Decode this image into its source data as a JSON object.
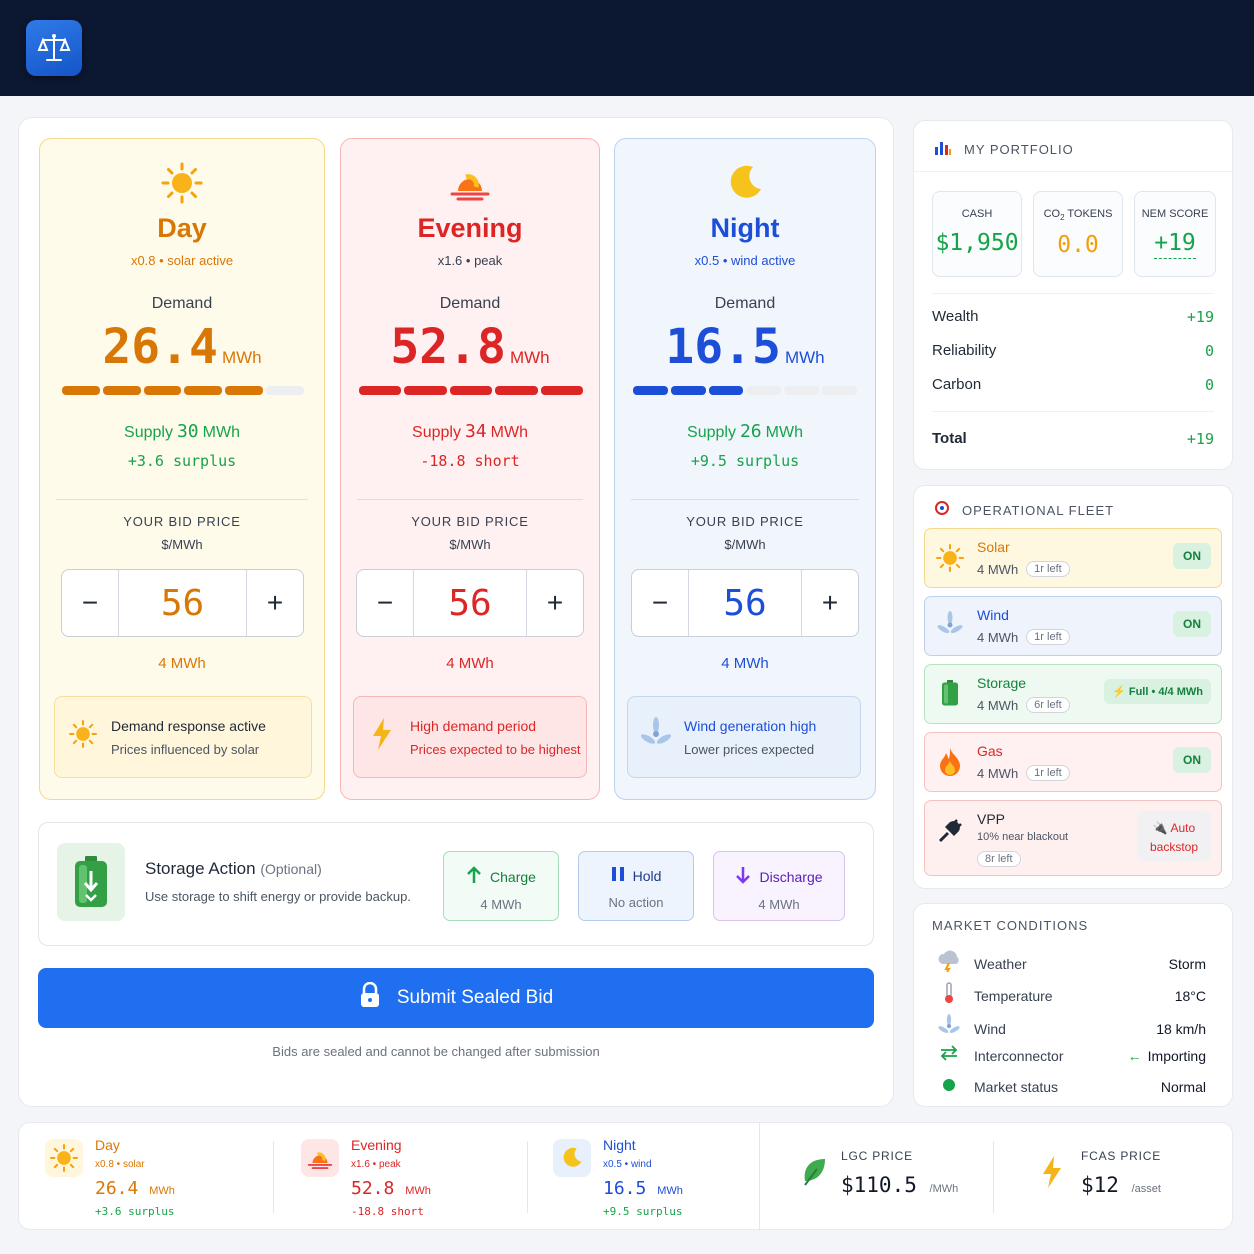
{
  "colors": {
    "day": "#d97706",
    "evening": "#dc2626",
    "night": "#1d4ed8",
    "green": "#16a34a",
    "primary": "#1f6ff0"
  },
  "header": {
    "logo_icon": "scales-icon"
  },
  "periods": [
    {
      "name": "Day",
      "mult": "x0.8",
      "mult_note": "solar active",
      "demand_label": "Demand",
      "demand": "26.4",
      "unit": "MWh",
      "demand_fill": 0.82,
      "supply_label": "Supply",
      "supply": "30",
      "balance": "+3.6 surplus",
      "bid_label": "YOUR BID PRICE",
      "bid_unit": "$/MWh",
      "bid": "56",
      "qty": "4 MWh",
      "note_title": "Demand response active",
      "note_text": "Prices influenced by solar",
      "note_icon": "sun-icon"
    },
    {
      "name": "Evening",
      "mult": "x1.6",
      "mult_note": "peak",
      "demand_label": "Demand",
      "demand": "52.8",
      "unit": "MWh",
      "demand_fill": 1.0,
      "supply_label": "Supply",
      "supply": "34",
      "balance": "-18.8 short",
      "bid_label": "YOUR BID PRICE",
      "bid_unit": "$/MWh",
      "bid": "56",
      "qty": "4 MWh",
      "note_title": "High demand period",
      "note_text": "Prices expected to be highest",
      "note_icon": "lightning-icon"
    },
    {
      "name": "Night",
      "mult": "x0.5",
      "mult_note": "wind active",
      "demand_label": "Demand",
      "demand": "16.5",
      "unit": "MWh",
      "demand_fill": 0.52,
      "supply_label": "Supply",
      "supply": "26",
      "balance": "+9.5 surplus",
      "bid_label": "YOUR BID PRICE",
      "bid_unit": "$/MWh",
      "bid": "56",
      "qty": "4 MWh",
      "note_title": "Wind generation high",
      "note_text": "Lower prices expected",
      "note_icon": "wind-turbine-icon"
    }
  ],
  "storage": {
    "title": "Storage Action",
    "optional": "(Optional)",
    "desc": "Use storage to shift energy or provide backup.",
    "charge": {
      "label": "Charge",
      "sub": "4 MWh"
    },
    "hold": {
      "label": "Hold",
      "sub": "No action"
    },
    "discharge": {
      "label": "Discharge",
      "sub": "4 MWh"
    }
  },
  "submit": {
    "label": "Submit Sealed Bid",
    "note": "Bids are sealed and cannot be changed after submission"
  },
  "portfolio": {
    "title": "MY PORTFOLIO",
    "cash_label": "CASH",
    "cash": "$1,950",
    "co2_label": "CO",
    "co2_sub": "2",
    "co2_label2": " TOKENS",
    "co2": "0.0",
    "nem_label": "NEM SCORE",
    "nem": "+19",
    "rows": [
      {
        "label": "Wealth",
        "value": "+19"
      },
      {
        "label": "Reliability",
        "value": "0"
      },
      {
        "label": "Carbon",
        "value": "0"
      }
    ],
    "total_label": "Total",
    "total": "+19"
  },
  "fleet": {
    "title": "OPERATIONAL FLEET",
    "items": [
      {
        "name": "Solar",
        "cap": "4 MWh",
        "left": "1r left",
        "status": "ON"
      },
      {
        "name": "Wind",
        "cap": "4 MWh",
        "left": "1r left",
        "status": "ON"
      },
      {
        "name": "Storage",
        "cap": "4 MWh",
        "left": "6r left",
        "status": "Full • 4/4 MWh"
      },
      {
        "name": "Gas",
        "cap": "4 MWh",
        "left": "1r left",
        "status": "ON"
      },
      {
        "name": "VPP",
        "cap": "10% near blackout",
        "left": "8r left",
        "status_1": "Auto",
        "status_2": "backstop"
      }
    ]
  },
  "market": {
    "title": "MARKET CONDITIONS",
    "rows": [
      {
        "label": "Weather",
        "value": "Storm"
      },
      {
        "label": "Temperature",
        "value": "18°C"
      },
      {
        "label": "Wind",
        "value": "18 km/h"
      },
      {
        "label": "Interconnector",
        "value": "Importing"
      },
      {
        "label": "Market status",
        "value": "Normal"
      }
    ]
  },
  "summary": {
    "day": {
      "name": "Day",
      "meta": "x0.8 • solar",
      "value": "26.4",
      "unit": "MWh",
      "balance": "+3.6 surplus"
    },
    "evening": {
      "name": "Evening",
      "meta": "x1.6 • peak",
      "value": "52.8",
      "unit": "MWh",
      "balance": "-18.8 short"
    },
    "night": {
      "name": "Night",
      "meta": "x0.5 • wind",
      "value": "16.5",
      "unit": "MWh",
      "balance": "+9.5 surplus"
    },
    "lgc": {
      "label": "LGC PRICE",
      "value": "$110.5",
      "unit": "/MWh"
    },
    "fcas": {
      "label": "FCAS PRICE",
      "value": "$12",
      "unit": "/asset"
    }
  }
}
